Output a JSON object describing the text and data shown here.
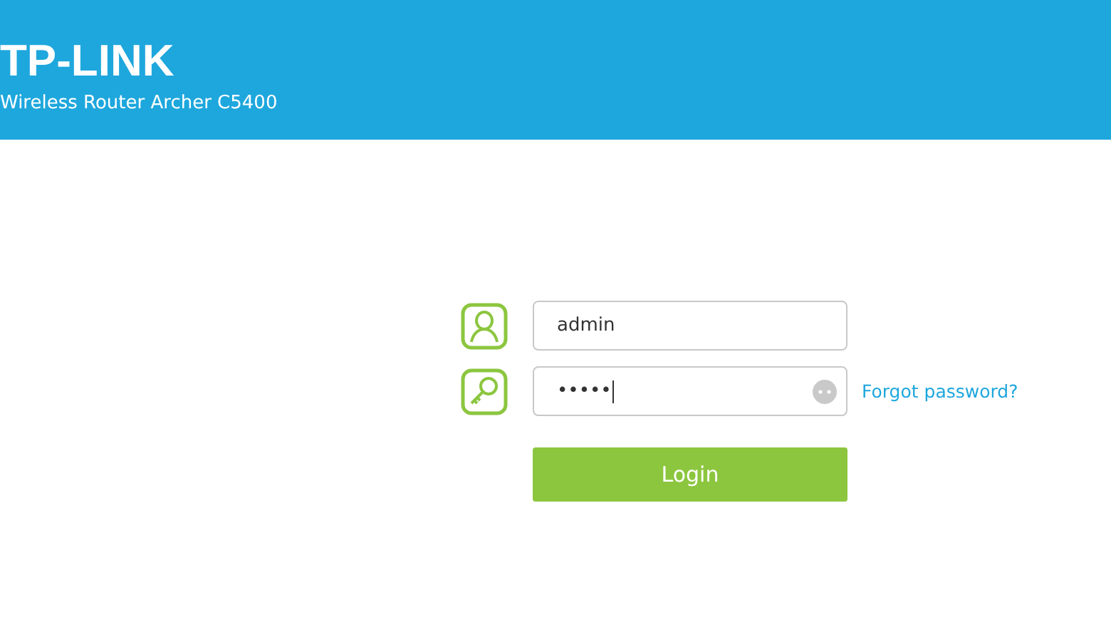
{
  "header": {
    "logo": "TP-LINK",
    "subtitle": "Wireless Router Archer C5400"
  },
  "login": {
    "username": {
      "value": "admin"
    },
    "password": {
      "value": "•••••"
    },
    "forgot_link": "Forgot password?",
    "button": "Login"
  }
}
